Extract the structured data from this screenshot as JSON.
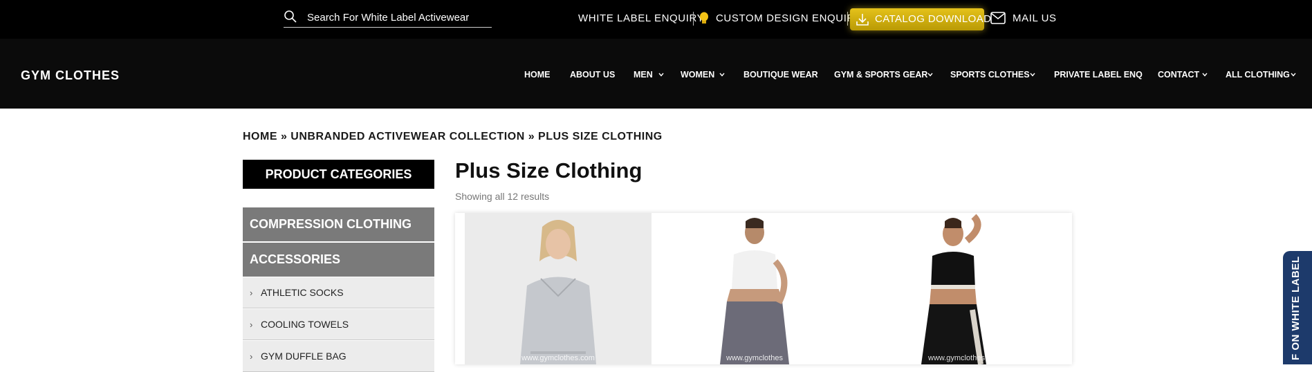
{
  "topbar": {
    "search_placeholder": "Search For White Label Activewear",
    "white_label": "WHITE LABEL ENQUIRY",
    "custom_design": "CUSTOM DESIGN ENQUIRY",
    "catalog": "CATALOG DOWNLOAD",
    "mail": "MAIL US"
  },
  "nav": {
    "logo": "GYM CLOTHES",
    "items": [
      {
        "label": "HOME"
      },
      {
        "label": "ABOUT US"
      },
      {
        "label": "MEN"
      },
      {
        "label": "WOMEN"
      },
      {
        "label": "BOUTIQUE WEAR"
      },
      {
        "label": "GYM & SPORTS GEAR"
      },
      {
        "label": "SPORTS CLOTHES"
      },
      {
        "label": "PRIVATE LABEL ENQ"
      },
      {
        "label": "CONTACT"
      },
      {
        "label": "ALL CLOTHING"
      }
    ]
  },
  "breadcrumb": "HOME » UNBRANDED ACTIVEWEAR COLLECTION » PLUS SIZE CLOTHING",
  "sidebar": {
    "header": "PRODUCT CATEGORIES",
    "main": [
      "COMPRESSION CLOTHING",
      "ACCESSORIES"
    ],
    "sub": [
      "ATHLETIC SOCKS",
      "COOLING TOWELS",
      "GYM DUFFLE BAG"
    ]
  },
  "main": {
    "title": "Plus Size Clothing",
    "results": "Showing all 12 results",
    "watermarks": [
      "www.gymclothes.com",
      "www.gymclothes",
      "www.gymclothes"
    ]
  },
  "side_tab": "F ON WHITE LABEL",
  "colors": {
    "accent_gold": "#d4b10f",
    "side_tab": "#1d3a6b",
    "category_grey": "#7a7a7a"
  }
}
